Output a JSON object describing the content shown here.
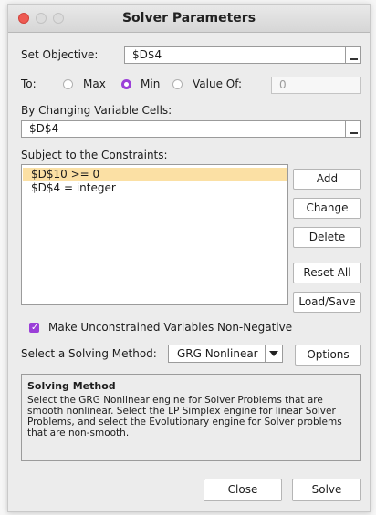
{
  "window": {
    "title": "Solver Parameters"
  },
  "objective": {
    "label": "Set Objective:",
    "value": "$D$4"
  },
  "to": {
    "label": "To:",
    "options": [
      {
        "label": "Max",
        "selected": false
      },
      {
        "label": "Min",
        "selected": true
      },
      {
        "label": "Value Of:",
        "selected": false
      }
    ],
    "value_of": "0"
  },
  "variable_cells": {
    "label": "By Changing Variable Cells:",
    "value": "$D$4"
  },
  "constraints": {
    "label": "Subject to the Constraints:",
    "items": [
      "$D$10 >= 0",
      "$D$4 = integer"
    ],
    "selected_index": 0
  },
  "constraint_buttons": {
    "add": "Add",
    "change": "Change",
    "delete": "Delete",
    "reset_all": "Reset All",
    "load_save": "Load/Save"
  },
  "non_negative": {
    "label": "Make Unconstrained Variables Non-Negative",
    "checked": true
  },
  "solving_method": {
    "label": "Select a Solving Method:",
    "selected": "GRG Nonlinear",
    "options_button": "Options"
  },
  "description": {
    "title": "Solving Method",
    "body": "Select the GRG Nonlinear engine for Solver Problems that are smooth nonlinear. Select the LP Simplex engine for linear Solver Problems, and select the Evolutionary engine for Solver problems that are non-smooth."
  },
  "footer": {
    "close": "Close",
    "solve": "Solve"
  },
  "colors": {
    "accent": "#9b3fd8",
    "selection": "#fbe0a4",
    "close_light": "#ee5a52"
  },
  "icons": {
    "collapse_objective": "range-select-icon",
    "collapse_variables": "range-select-icon",
    "dropdown": "chevron-down-icon"
  }
}
